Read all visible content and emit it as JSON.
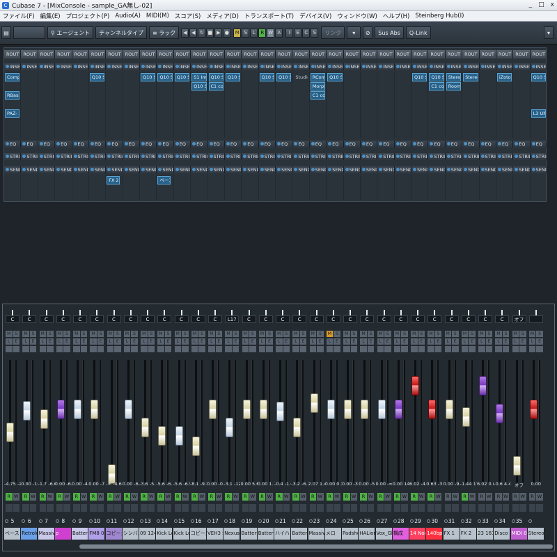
{
  "window": {
    "title": "Cubase 7 - [MixConsole - sample_GA無し-02]",
    "buttons": [
      "_",
      "□",
      "x"
    ]
  },
  "menu": [
    "ファイル(F)",
    "編集(E)",
    "プロジェクト(P)",
    "Audio(A)",
    "MIDI(M)",
    "スコア(S)",
    "メディア(D)",
    "トランスポート(T)",
    "デバイス(V)",
    "ウィンドウ(W)",
    "ヘルプ(H)",
    "Steinberg Hub(I)"
  ],
  "toolbar": {
    "agent": "エージェント",
    "channel_type": "チャンネルタイプ",
    "rack": "ラック",
    "link": "リンク",
    "sus_abs": "Sus Abs",
    "qlink": "Q-Link",
    "states": [
      "M",
      "S",
      "L",
      "R",
      "W",
      "A"
    ],
    "misc": [
      "I",
      "E",
      "C",
      "S"
    ]
  },
  "racks": {
    "route_label": "ROUT",
    "insert_label": "INSEI",
    "eq_label": "EQ",
    "strip_label": "STRII",
    "send_label": "SEND",
    "inserts": [
      [
        "Compi",
        "RBass",
        "PAZ- A"
      ],
      [],
      [],
      [],
      [],
      [
        "Q10 S"
      ],
      [],
      [],
      [
        "Q10 S"
      ],
      [
        "Q10 S"
      ],
      [
        "Q10 S"
      ],
      [
        "S1 Im",
        "Q10 S"
      ],
      [
        "Q10 S",
        "C1 cor"
      ],
      [
        "Q10 S"
      ],
      [],
      [
        "Q10 S"
      ],
      [
        "Q10 S"
      ],
      [
        "Studio"
      ],
      [
        "RCom",
        "Morpf",
        "C1 cor"
      ],
      [
        "Q10 S"
      ],
      [],
      [],
      [],
      [],
      [
        "Q10 S"
      ],
      [
        "Q10 S",
        "C1 cor"
      ],
      [
        "Sterec",
        "Room"
      ],
      [
        "Sterec"
      ],
      [],
      [
        "iZotop"
      ],
      [],
      [
        "Q10 S",
        "L3 Ult"
      ]
    ],
    "sends": [
      [],
      [],
      [],
      [],
      [],
      [],
      [
        "FX 2"
      ],
      [],
      [],
      [
        "ベース"
      ]
    ]
  },
  "mixer": {
    "channels": [
      {
        "pan": "C",
        "vol": "-4.75",
        "vol2": "-2.8",
        "num": "5",
        "name": "ベース",
        "level": 0.4,
        "color": "#b8c2cc",
        "rec": true
      },
      {
        "pan": "C",
        "vol": "0.00",
        "vol2": "-10.7",
        "num": "6",
        "name": "Retrolox",
        "level": 0.61,
        "color": "#6aa0e8",
        "rec": true
      },
      {
        "pan": "C",
        "vol": "-1.7",
        "vol2": "-6.6",
        "num": "7",
        "name": "Massive",
        "level": 0.53,
        "color": "#c8c8e8",
        "rec": true
      },
      {
        "pan": "C",
        "vol": "0.00",
        "vol2": "-6.7",
        "num": "8",
        "name": "p",
        "level": 0.62,
        "color": "#d040d0",
        "rec": true
      },
      {
        "pan": "C",
        "vol": "0.00",
        "vol2": "-4.7",
        "num": "9",
        "name": "Battery",
        "level": 0.62,
        "color": "#c8c8e8",
        "rec": true
      },
      {
        "pan": "C",
        "vol": "0.00",
        "vol2": "-7.5",
        "num": "10",
        "name": "FM8 05",
        "level": 0.62,
        "color": "#b0a0e8",
        "rec": true
      },
      {
        "pan": "C",
        "vol": "-∞",
        "vol2": "-4.6",
        "num": "11",
        "name": "コピー元",
        "level": 0.0,
        "color": "#a088d0",
        "rec": true
      },
      {
        "pan": "C",
        "vol": "0.00",
        "vol2": "-6.3",
        "num": "12",
        "name": "シンバル",
        "level": 0.62,
        "color": "#b8c2cc",
        "rec": true
      },
      {
        "pan": "C",
        "vol": "-3.6",
        "vol2": "-5.1",
        "num": "13",
        "name": "09 124",
        "level": 0.45,
        "color": "#b8c2cc",
        "rec": true
      },
      {
        "pan": "C",
        "vol": "-5.6",
        "vol2": "-6.5",
        "num": "14",
        "name": "Kick Lo",
        "level": 0.37,
        "color": "#b8c2cc",
        "rec": true
      },
      {
        "pan": "C",
        "vol": "-5.6",
        "vol2": "-6.5",
        "num": "15",
        "name": "Kick Lo",
        "level": 0.37,
        "color": "#b8c2cc",
        "rec": true
      },
      {
        "pan": "C",
        "vol": "-8.1",
        "vol2": "-9.2",
        "num": "16",
        "name": "コピー元",
        "level": 0.27,
        "color": "#b8c2cc",
        "rec": true
      },
      {
        "pan": "C",
        "vol": "0.00",
        "vol2": "-0.2",
        "num": "17",
        "name": "VEH3 S",
        "level": 0.62,
        "color": "#b8c2cc",
        "rec": true
      },
      {
        "pan": "L17",
        "vol": "-3.1",
        "vol2": "-12.6",
        "num": "18",
        "name": "Nexus",
        "level": 0.45,
        "color": "#b8c2cc",
        "rec": true
      },
      {
        "pan": "C",
        "vol": "0.00",
        "vol2": "5.6",
        "num": "19",
        "name": "Battery",
        "level": 0.62,
        "color": "#b8c2cc",
        "rec": true
      },
      {
        "pan": "C",
        "vol": "0.00",
        "vol2": "1.7",
        "num": "20",
        "name": "Battery",
        "level": 0.62,
        "color": "#b8c2cc",
        "rec": true
      },
      {
        "pan": "C",
        "vol": "-0.4",
        "vol2": "-1.6",
        "num": "21",
        "name": "ハイハット",
        "level": 0.6,
        "color": "#b8c2cc",
        "rec": true
      },
      {
        "pan": "C",
        "vol": "-3.2",
        "vol2": "-6.2",
        "num": "22",
        "name": "Battery",
        "level": 0.45,
        "color": "#b8c2cc",
        "rec": true
      },
      {
        "pan": "C",
        "vol": "2.07",
        "vol2": "1.4",
        "num": "23",
        "name": "Massive",
        "level": 0.68,
        "color": "#b8c2cc",
        "rec": true
      },
      {
        "pan": "C",
        "vol": "0.00",
        "vol2": "0.3",
        "num": "24",
        "name": "メロ",
        "level": 0.62,
        "color": "#b8c2cc",
        "rec": true
      },
      {
        "pan": "C",
        "vol": "0.00",
        "vol2": "-3.7",
        "num": "25",
        "name": "Padsho",
        "level": 0.62,
        "color": "#b8c2cc",
        "rec": true
      },
      {
        "pan": "C",
        "vol": "0.00",
        "vol2": "-5.4",
        "num": "26",
        "name": "HALion",
        "level": 0.62,
        "color": "#b8c2cc",
        "rec": true
      },
      {
        "pan": "C",
        "vol": "0.00",
        "vol2": "-∞",
        "num": "27",
        "name": "Vox_Gli",
        "level": 0.62,
        "color": "#b8c2cc",
        "rec": true
      },
      {
        "pan": "C",
        "vol": "0.00",
        "vol2": "14.5",
        "num": "28",
        "name": "構成",
        "level": 0.62,
        "color": "#e060e0",
        "rec": true
      },
      {
        "pan": "C",
        "vol": "6.02",
        "vol2": "-4.9",
        "num": "29",
        "name": "14 Nois",
        "level": 0.85,
        "color": "#ff4060",
        "rec": true
      },
      {
        "pan": "C",
        "vol": "0.63",
        "vol2": "-3.7",
        "num": "30",
        "name": "140bpm",
        "level": 0.62,
        "color": "#ff3040",
        "rec": true
      },
      {
        "pan": "C",
        "vol": "0.00",
        "vol2": "-9.4",
        "num": "31",
        "name": "FX 1",
        "level": 0.62,
        "color": "#b8c2cc",
        "rec": false
      },
      {
        "pan": "C",
        "vol": "-1.44",
        "vol2": "17.5",
        "num": "32",
        "name": "FX 2",
        "level": 0.55,
        "color": "#b8c2cc",
        "rec": true
      },
      {
        "pan": "C",
        "vol": "6.02",
        "vol2": "0.0",
        "num": "33",
        "name": "23 161",
        "level": 0.85,
        "color": "#b8c2cc",
        "rec": false
      },
      {
        "pan": "C",
        "vol": "-0.6",
        "vol2": "4.4",
        "num": "34",
        "name": "Disco K",
        "level": 0.58,
        "color": "#b8c2cc",
        "rec": false
      },
      {
        "pan": "オフ",
        "vol": "オフ",
        "vol2": "",
        "num": "35",
        "name": "MIDI 01",
        "level": 0.08,
        "color": "#c060d0",
        "rec": false
      },
      {
        "pan": "",
        "vol": "0.00",
        "vol2": "",
        "num": "",
        "name": "Stereo",
        "level": 0.62,
        "color": "#b8c2cc",
        "rec": false
      }
    ],
    "mute_on_index": 19
  }
}
